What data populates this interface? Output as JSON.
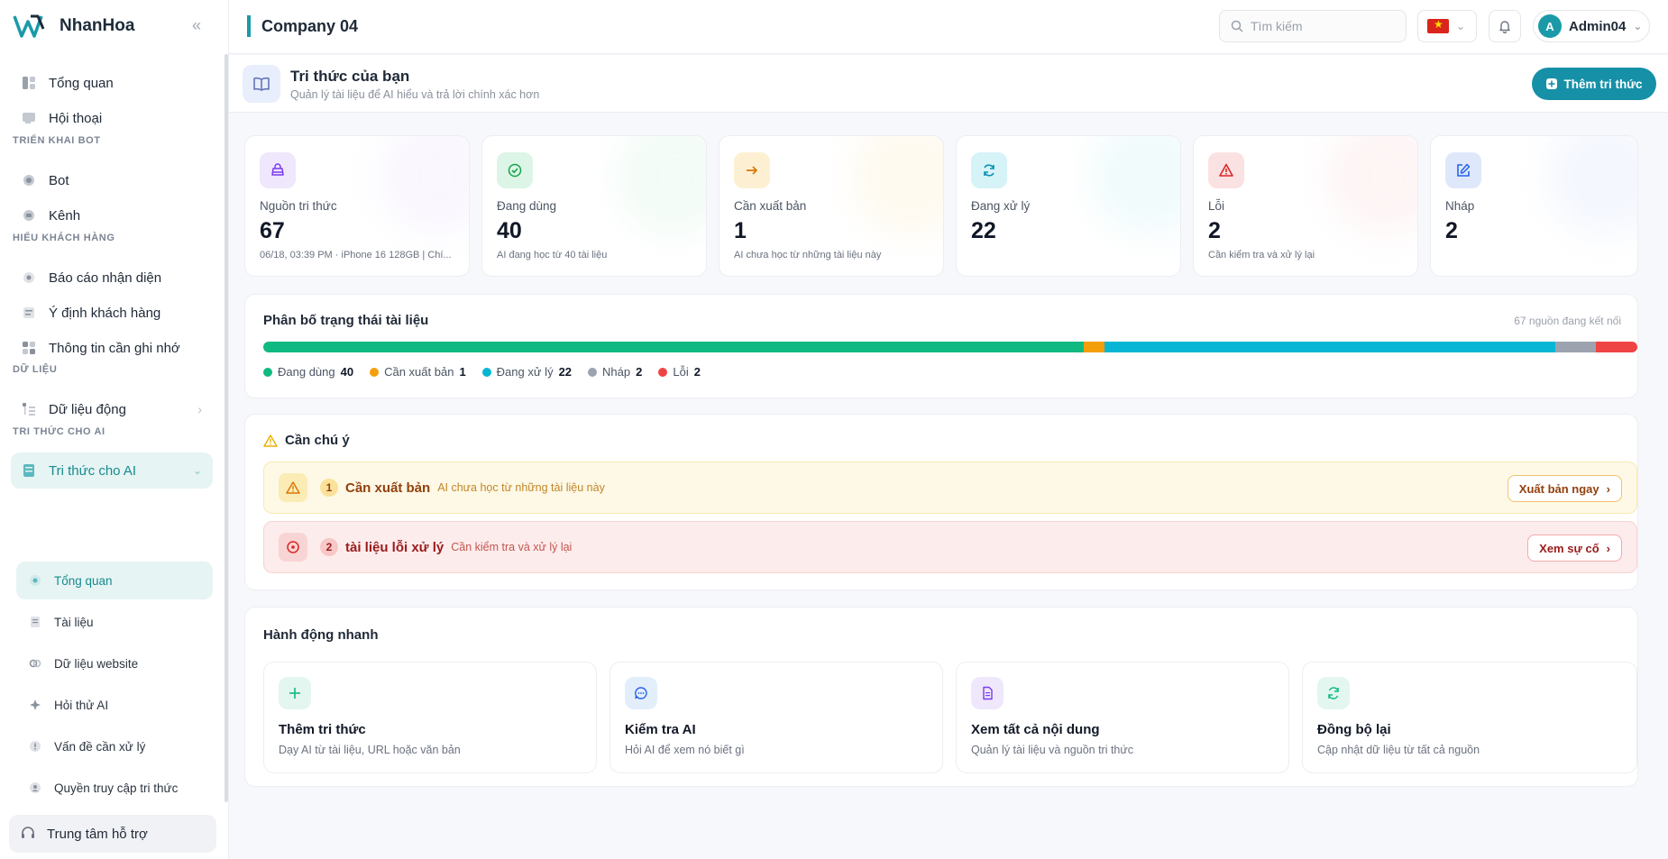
{
  "brand": {
    "name": "NhanHoa"
  },
  "sidebar": {
    "top_items": [
      {
        "label": "Tổng quan"
      },
      {
        "label": "Hội thoại"
      }
    ],
    "sections": [
      {
        "title": "TRIỂN KHAI BOT",
        "items": [
          {
            "label": "Bot"
          },
          {
            "label": "Kênh"
          }
        ]
      },
      {
        "title": "HIỂU KHÁCH HÀNG",
        "items": [
          {
            "label": "Báo cáo nhận diện"
          },
          {
            "label": "Ý định khách hàng"
          },
          {
            "label": "Thông tin cần ghi nhớ"
          }
        ]
      },
      {
        "title": "DỮ LIỆU",
        "items": [
          {
            "label": "Dữ liệu động"
          }
        ]
      },
      {
        "title": "TRI THỨC CHO AI",
        "items": [
          {
            "label": "Tri thức cho AI"
          }
        ]
      }
    ],
    "sub_items": [
      {
        "label": "Tổng quan"
      },
      {
        "label": "Tài liệu"
      },
      {
        "label": "Dữ liệu website"
      },
      {
        "label": "Hỏi thử AI"
      },
      {
        "label": "Vấn đề cần xử lý"
      },
      {
        "label": "Quyền truy cập tri thức"
      }
    ],
    "support": "Trung tâm hỗ trợ"
  },
  "header": {
    "company": "Company 04",
    "search_placeholder": "Tìm kiếm",
    "user": {
      "initial": "A",
      "name": "Admin04"
    }
  },
  "page": {
    "title": "Tri thức của bạn",
    "subtitle": "Quản lý tài liệu để AI hiểu và trả lời chính xác hơn",
    "add_button": "Thêm tri thức"
  },
  "stats": [
    {
      "label": "Nguồn tri thức",
      "value": "67",
      "desc": "06/18, 03:39 PM · iPhone 16 128GB | Chí...",
      "color": "#7c3aed",
      "bg": "#efe7fb"
    },
    {
      "label": "Đang dùng",
      "value": "40",
      "desc": "AI đang học từ 40 tài liệu",
      "color": "#16a34a",
      "bg": "#dcf5e6"
    },
    {
      "label": "Cần xuất bản",
      "value": "1",
      "desc": "AI chưa học từ những tài liệu này",
      "color": "#d97706",
      "bg": "#fdf0d2"
    },
    {
      "label": "Đang xử lý",
      "value": "22",
      "desc": "",
      "color": "#0891b2",
      "bg": "#d6f3f7"
    },
    {
      "label": "Lỗi",
      "value": "2",
      "desc": "Cần kiểm tra và xử lý lại",
      "color": "#dc2626",
      "bg": "#fbe2e2"
    },
    {
      "label": "Nháp",
      "value": "2",
      "desc": "",
      "color": "#2563eb",
      "bg": "#dfe8fb"
    }
  ],
  "distribution": {
    "title": "Phân bố trạng thái tài liệu",
    "summary": "67 nguồn đang kết nối",
    "segments": [
      {
        "label": "Đang dùng",
        "value": 40,
        "color": "#10b981"
      },
      {
        "label": "Cần xuất bản",
        "value": 1,
        "color": "#f59e0b"
      },
      {
        "label": "Đang xử lý",
        "value": 22,
        "color": "#06b6d4"
      },
      {
        "label": "Nháp",
        "value": 2,
        "color": "#9ca3af"
      },
      {
        "label": "Lỗi",
        "value": 2,
        "color": "#ef4444"
      }
    ]
  },
  "attention": {
    "title": "Cần chú ý",
    "alerts": [
      {
        "count": "1",
        "title": "Cần xuất bản",
        "desc": "AI chưa học từ những tài liệu này",
        "button": "Xuất bản ngay"
      },
      {
        "count": "2",
        "title": "tài liệu lỗi xử lý",
        "desc": "Cần kiểm tra và xử lý lại",
        "button": "Xem sự cố"
      }
    ]
  },
  "quick_actions": {
    "title": "Hành động nhanh",
    "items": [
      {
        "title": "Thêm tri thức",
        "desc": "Dạy AI từ tài liệu, URL hoặc văn bản",
        "icon": "plus-icon"
      },
      {
        "title": "Kiểm tra AI",
        "desc": "Hỏi AI để xem nó biết gì",
        "icon": "chat-icon"
      },
      {
        "title": "Xem tất cả nội dung",
        "desc": "Quản lý tài liệu và nguồn tri thức",
        "icon": "document-icon"
      },
      {
        "title": "Đồng bộ lại",
        "desc": "Cập nhật dữ liệu từ tất cả nguồn",
        "icon": "sync-icon"
      }
    ]
  }
}
